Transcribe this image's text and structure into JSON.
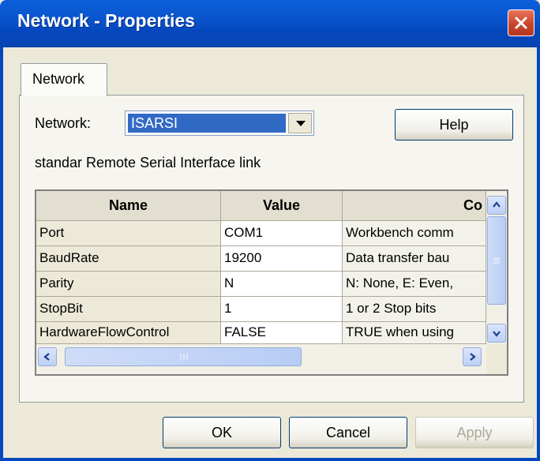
{
  "window": {
    "title": "Network - Properties"
  },
  "tabs": [
    {
      "label": "Network"
    }
  ],
  "network": {
    "label": "Network:",
    "selected": "ISARSI",
    "description": "standar Remote Serial Interface link"
  },
  "buttons": {
    "help": "Help",
    "ok": "OK",
    "cancel": "Cancel",
    "apply": "Apply"
  },
  "grid": {
    "columns": [
      "Name",
      "Value",
      "Co"
    ],
    "rows": [
      {
        "name": "Port",
        "value": "COM1",
        "comment": "Workbench comm"
      },
      {
        "name": "BaudRate",
        "value": "19200",
        "comment": "Data transfer bau"
      },
      {
        "name": "Parity",
        "value": "N",
        "comment": "N: None, E: Even, "
      },
      {
        "name": "StopBit",
        "value": "1",
        "comment": "1 or 2 Stop bits"
      },
      {
        "name": "HardwareFlowControl",
        "value": "FALSE",
        "comment": "TRUE when using"
      }
    ]
  },
  "icons": [
    "close-icon",
    "chevron-down-icon",
    "scroll-up-icon",
    "scroll-down-icon",
    "scroll-left-icon",
    "scroll-right-icon"
  ],
  "colors": {
    "titlebar": "#0548be",
    "selection": "#316ac5",
    "close": "#c8452c"
  }
}
